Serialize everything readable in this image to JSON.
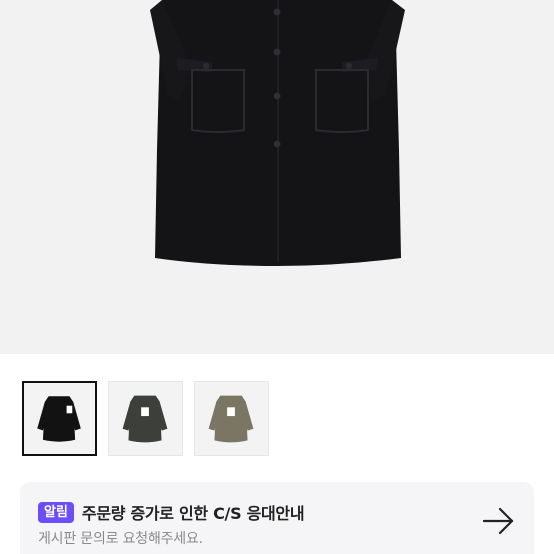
{
  "product": {
    "image_alt": "black wool long coat",
    "thumbnails": [
      {
        "color_name": "black",
        "color": "#121212",
        "selected": true
      },
      {
        "color_name": "charcoal",
        "color": "#3c3f3a",
        "selected": false
      },
      {
        "color_name": "khaki",
        "color": "#7b7563",
        "selected": false
      }
    ]
  },
  "notice": {
    "badge": "알림",
    "title": "주문량 증가로 인한 C/S 응대안내",
    "subtitle": "게시판 문의로 요청해주세요.",
    "icon": "arrow-right-icon"
  },
  "colors": {
    "accent": "#6b4ef5",
    "hero_bg": "#f2f2f2",
    "notice_bg": "#f5f5f7"
  }
}
